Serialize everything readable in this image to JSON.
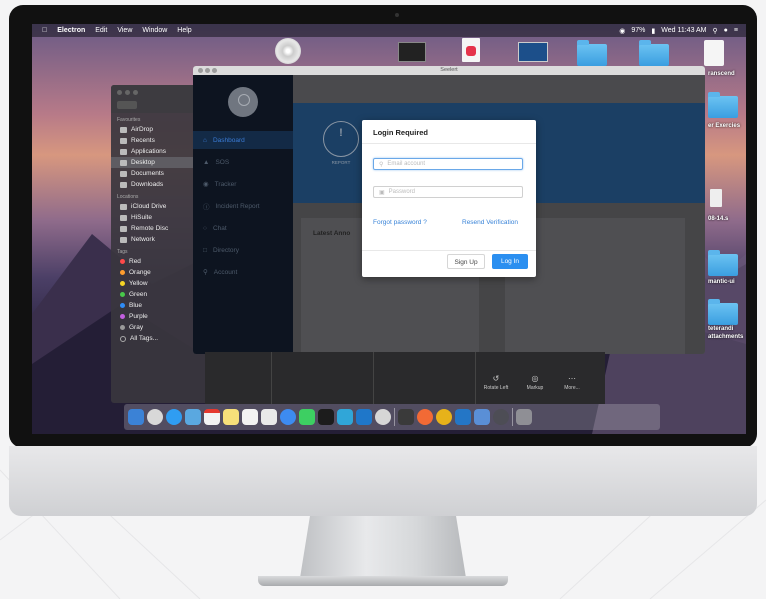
{
  "menubar": {
    "apple": "",
    "app": "Electron",
    "items": [
      "Edit",
      "View",
      "Window",
      "Help"
    ],
    "battery": "97%",
    "clock": "Wed 11:43 AM"
  },
  "desktop": {
    "icons": [
      {
        "label": "ranscend"
      },
      {
        "label": "er Exercies"
      },
      {
        "label": "08-14.s"
      },
      {
        "label": "mantic-ui"
      },
      {
        "label": "teterandi"
      },
      {
        "label": "attachments"
      }
    ]
  },
  "finder": {
    "favourites_title": "Favourites",
    "favourites": [
      "AirDrop",
      "Recents",
      "Applications",
      "Desktop",
      "Documents",
      "Downloads"
    ],
    "locations_title": "Locations",
    "locations": [
      "iCloud Drive",
      "HiSuite",
      "Remote Disc",
      "Network"
    ],
    "tags_title": "Tags",
    "tags": [
      {
        "label": "Red",
        "color": "#ff4a4a"
      },
      {
        "label": "Orange",
        "color": "#ff9d2e"
      },
      {
        "label": "Yellow",
        "color": "#f5d425"
      },
      {
        "label": "Green",
        "color": "#48c84a"
      },
      {
        "label": "Blue",
        "color": "#2f8cf7"
      },
      {
        "label": "Purple",
        "color": "#c35fe0"
      },
      {
        "label": "Gray",
        "color": "#9a9a9a"
      }
    ],
    "all_tags": "All Tags..."
  },
  "app": {
    "window_title": "Seelert",
    "nav": [
      "Dashboard",
      "SOS",
      "Tracker",
      "Incident Report",
      "Chat",
      "Directory",
      "Account"
    ],
    "report_label": "REPORT",
    "card_left_title": "Latest Anno",
    "card_right_title": "signs"
  },
  "login": {
    "title": "Login Required",
    "email_placeholder": "Email account",
    "password_placeholder": "Password",
    "forgot": "Forgot password ?",
    "resend": "Resend Verification",
    "signup": "Sign Up",
    "login": "Log In"
  },
  "preview_toolbar": {
    "rotate": "Rotate Left",
    "markup": "Markup",
    "more": "More..."
  },
  "colors": {
    "accent": "#2b8ff0",
    "sidebar": "#0d1420",
    "banner": "#1b3f64"
  }
}
